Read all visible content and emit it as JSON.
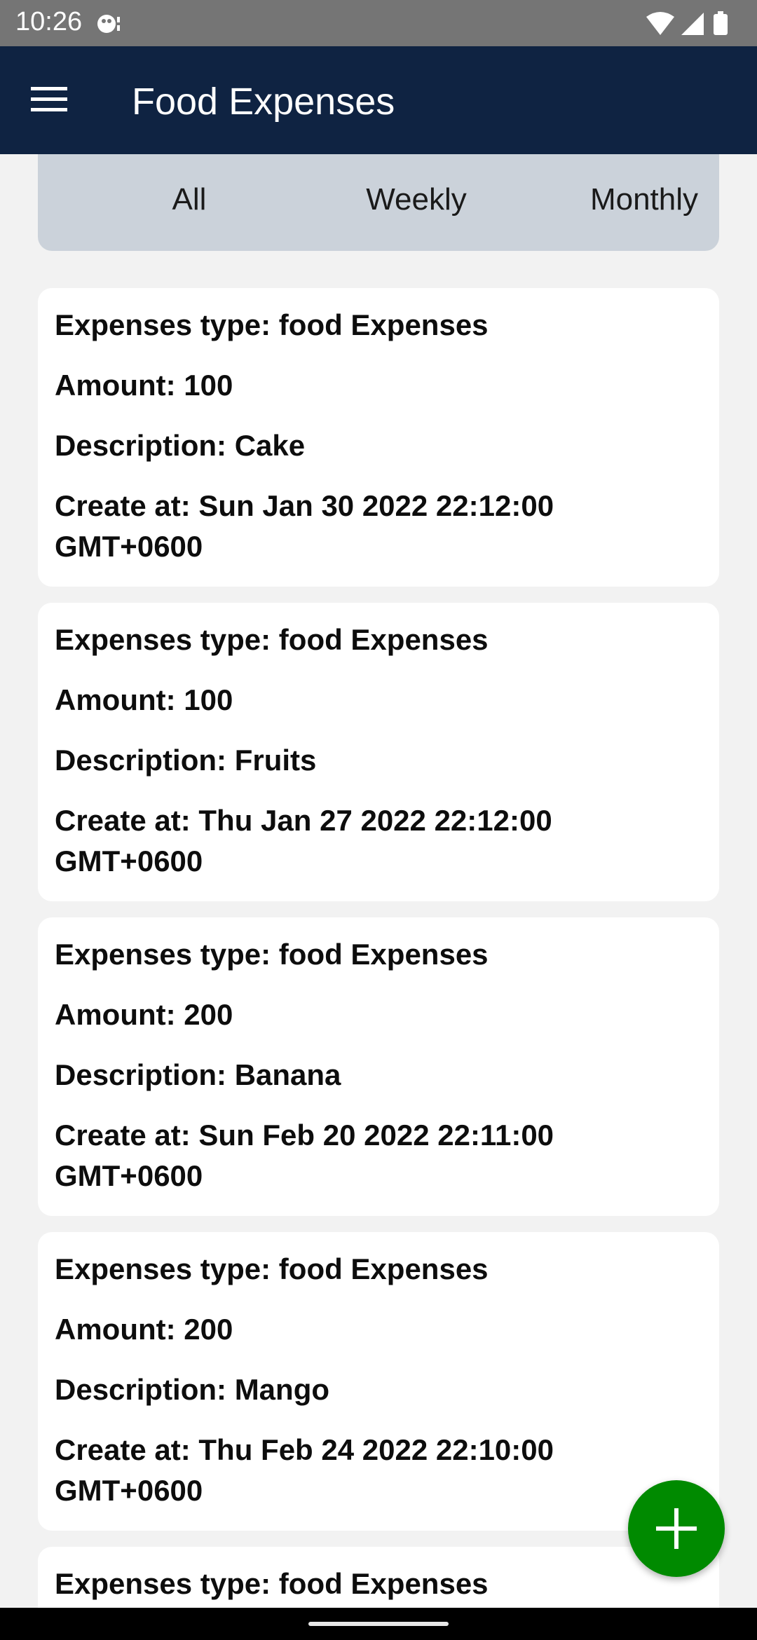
{
  "status_bar": {
    "time": "10:26"
  },
  "app_bar": {
    "title": "Food Expenses"
  },
  "filters": {
    "tabs": [
      "All",
      "Weekly",
      "Monthly"
    ]
  },
  "expenses": [
    {
      "type": "Expenses type: food Expenses",
      "amount": "Amount: 100",
      "description": "Description: Cake",
      "created": "Create at: Sun Jan 30 2022 22:12:00 GMT+0600"
    },
    {
      "type": "Expenses type: food Expenses",
      "amount": "Amount: 100",
      "description": "Description: Fruits",
      "created": "Create at: Thu Jan 27 2022 22:12:00 GMT+0600"
    },
    {
      "type": "Expenses type: food Expenses",
      "amount": "Amount: 200",
      "description": "Description: Banana",
      "created": "Create at: Sun Feb 20 2022 22:11:00 GMT+0600"
    },
    {
      "type": "Expenses type: food Expenses",
      "amount": "Amount: 200",
      "description": "Description: Mango",
      "created": "Create at: Thu Feb 24 2022 22:10:00 GMT+0600"
    },
    {
      "type": "Expenses type: food Expenses"
    }
  ],
  "colors": {
    "app_bar": "#0f2342",
    "filter_panel": "#cbd2da",
    "fab": "#008a00",
    "background": "#f2f2f2"
  },
  "icons": {
    "menu": "menu-icon",
    "add": "plus-icon",
    "wifi": "wifi-icon",
    "signal": "signal-icon",
    "battery": "battery-icon",
    "notification": "app-notification-icon"
  }
}
